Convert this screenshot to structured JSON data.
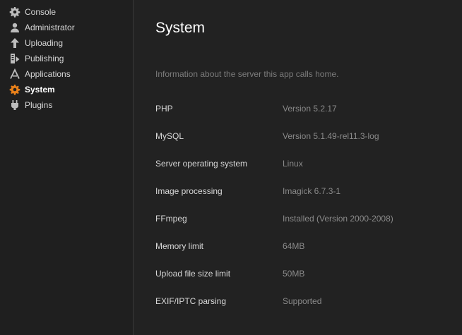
{
  "sidebar": {
    "items": [
      {
        "label": "Console",
        "icon": "gear-icon"
      },
      {
        "label": "Administrator",
        "icon": "user-icon"
      },
      {
        "label": "Uploading",
        "icon": "upload-arrow-icon"
      },
      {
        "label": "Publishing",
        "icon": "publish-icon"
      },
      {
        "label": "Applications",
        "icon": "applications-icon"
      },
      {
        "label": "System",
        "icon": "gear-icon",
        "active": true
      },
      {
        "label": "Plugins",
        "icon": "plug-icon"
      }
    ]
  },
  "main": {
    "title": "System",
    "description": "Information about the server this app calls home.",
    "rows": [
      {
        "label": "PHP",
        "value": "Version 5.2.17"
      },
      {
        "label": "MySQL",
        "value": "Version 5.1.49-rel11.3-log"
      },
      {
        "label": "Server operating system",
        "value": "Linux"
      },
      {
        "label": "Image processing",
        "value": "Imagick 6.7.3-1"
      },
      {
        "label": "FFmpeg",
        "value": "Installed (Version 2000-2008)"
      },
      {
        "label": "Memory limit",
        "value": "64MB"
      },
      {
        "label": "Upload file size limit",
        "value": "50MB"
      },
      {
        "label": "EXIF/IPTC parsing",
        "value": "Supported"
      }
    ]
  },
  "colors": {
    "accent": "#e8801a",
    "icon_default": "#bdbdbd",
    "background": "#222222",
    "sidebar_background": "#1f1f1f"
  }
}
